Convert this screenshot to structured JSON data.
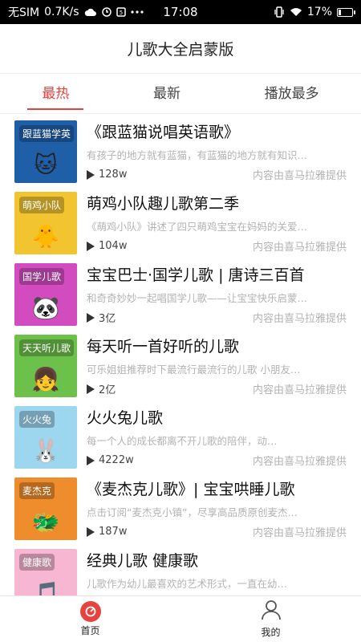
{
  "status_bar": {
    "carrier": "无SIM",
    "speed": "0.7K/s",
    "time": "17:08",
    "battery": "17%",
    "battery_level": 0.17
  },
  "header": {
    "title": "儿歌大全启蒙版"
  },
  "tabs": [
    {
      "label": "最热"
    },
    {
      "label": "最新"
    },
    {
      "label": "播放最多"
    }
  ],
  "items": [
    {
      "title": "《跟蓝猫说唱英语歌》",
      "desc": "有孩子的地方就有蓝猫，有蓝猫的地方就有知识…",
      "plays": "128w",
      "provider": "内容由喜马拉雅提供",
      "cover_tag": "跟蓝猫学英",
      "cover_mascot": "🐱",
      "cover_color": "#1f5fa8"
    },
    {
      "title": "萌鸡小队趣儿歌第二季",
      "desc": "《萌鸡小队》讲述了四只萌鸡宝宝在妈妈的关爱…",
      "plays": "104w",
      "provider": "内容由喜马拉雅提供",
      "cover_tag": "萌鸡小队",
      "cover_mascot": "🐥",
      "cover_color": "#f2c530"
    },
    {
      "title": "宝宝巴士·国学儿歌 | 唐诗三百首",
      "desc": "和奇奇妙妙一起唱国学儿歌——让宝宝快乐启蒙…",
      "plays": "3亿",
      "provider": "内容由喜马拉雅提供",
      "cover_tag": "国学儿歌",
      "cover_mascot": "🐼",
      "cover_color": "#d24cc0"
    },
    {
      "title": "每天听一首好听的儿歌",
      "desc": "可乐姐姐推荐时下最流行最流行的儿歌 小朋友…",
      "plays": "2亿",
      "provider": "内容由喜马拉雅提供",
      "cover_tag": "天天听儿歌",
      "cover_mascot": "👧",
      "cover_color": "#6cc14a"
    },
    {
      "title": "火火兔儿歌",
      "desc": "每一个人的成长都离不开儿歌的陪伴，动…",
      "plays": "4222w",
      "provider": "内容由喜马拉雅提供",
      "cover_tag": "火火兔",
      "cover_mascot": "🐰",
      "cover_color": "#9cd6ef"
    },
    {
      "title": "《麦杰克儿歌》| 宝宝哄睡儿歌",
      "desc": "点击订阅“麦杰克小镇”，尽享高品质原创麦杰…",
      "plays": "187w",
      "provider": "内容由喜马拉雅提供",
      "cover_tag": "麦杰克",
      "cover_mascot": "🐲",
      "cover_color": "#ef8c2b"
    },
    {
      "title": "经典儿歌 健康歌",
      "desc": "儿歌作为幼儿最喜欢的艺术形式，一直在幼…",
      "plays": "",
      "provider": "",
      "cover_tag": "健康歌",
      "cover_mascot": "🎵",
      "cover_color": "#f7b6d1"
    }
  ],
  "bottom_nav": [
    {
      "label": "首页",
      "icon": "home-icon",
      "active": true
    },
    {
      "label": "我的",
      "icon": "user-icon",
      "active": false
    }
  ],
  "colors": {
    "accent": "#e64340"
  }
}
